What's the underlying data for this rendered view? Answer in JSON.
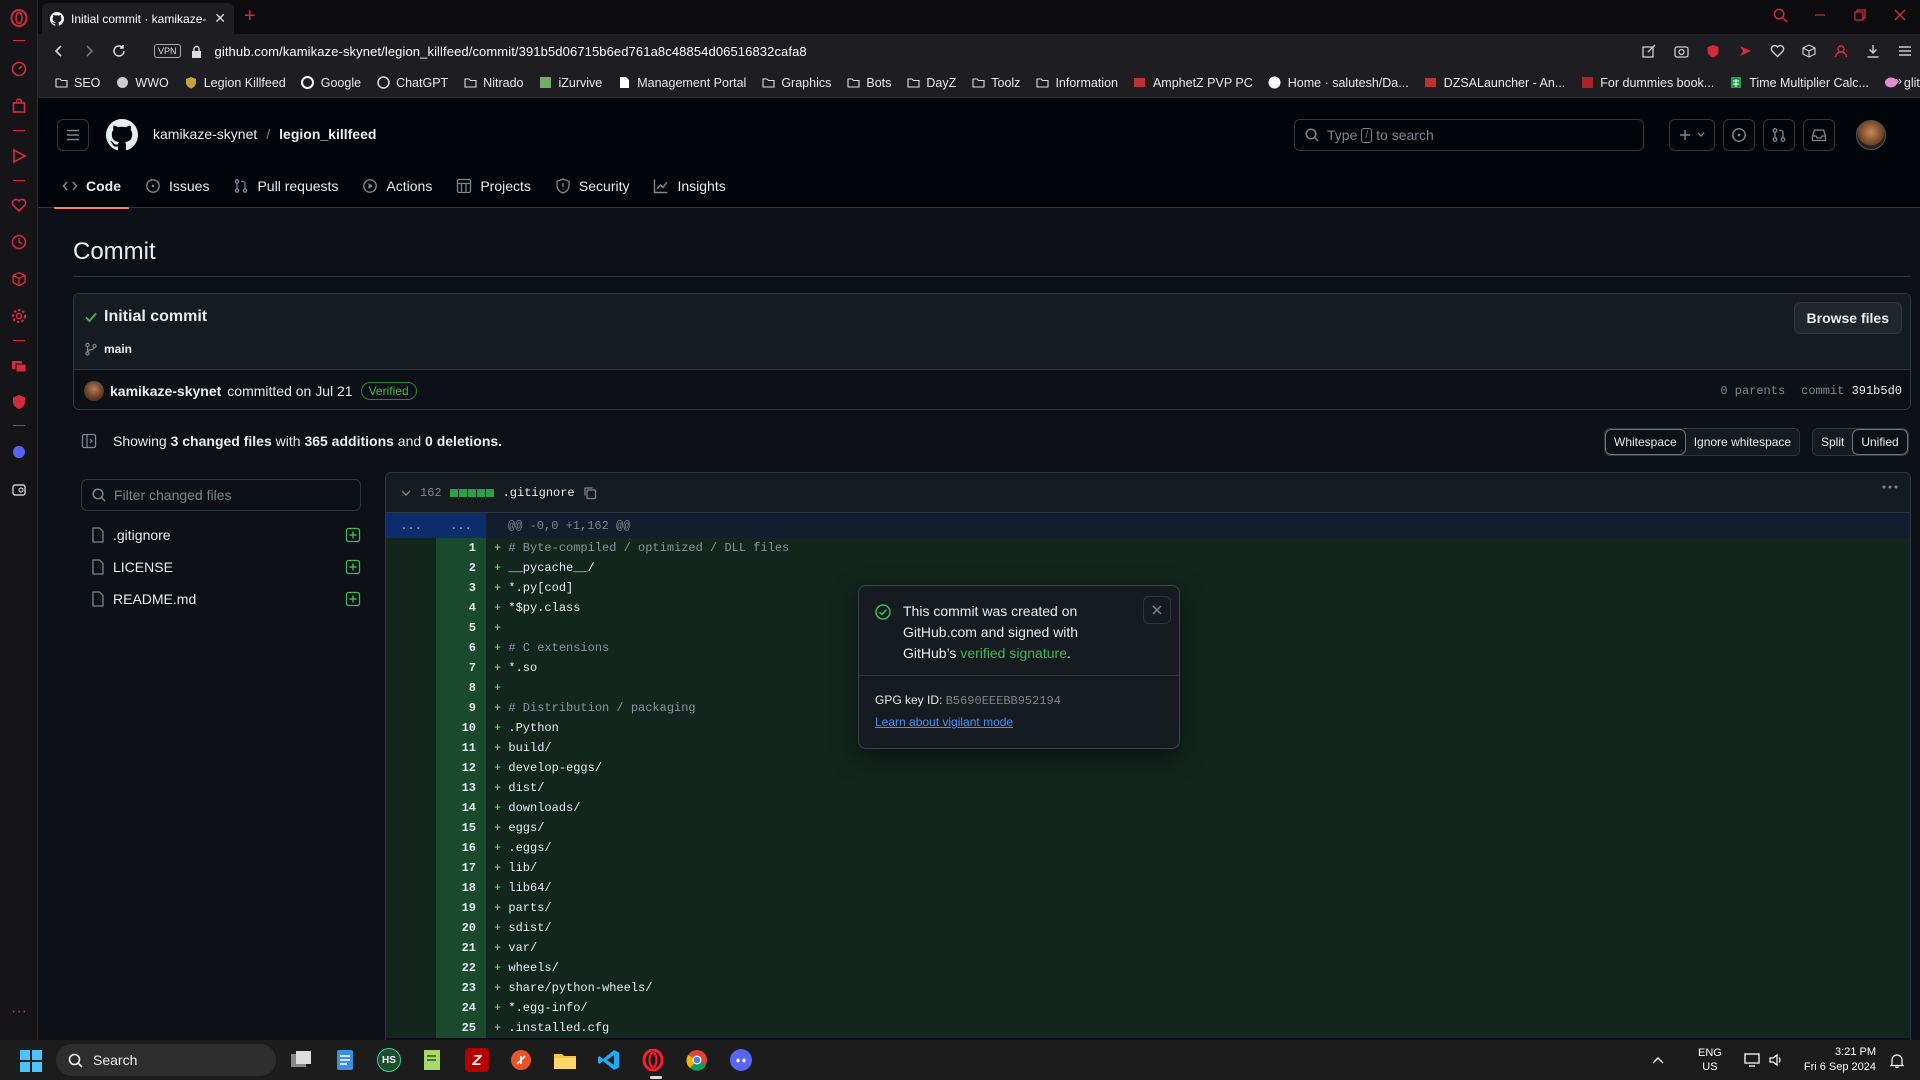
{
  "browser": {
    "tab_title": "Initial commit · kamikaze-s",
    "url": "github.com/kamikaze-skynet/legion_killfeed/commit/391b5d06715b6ed761a8c48854d06516832cafa8",
    "vpn_label": "VPN",
    "accent_color": "#d42a3c"
  },
  "bookmarks": [
    {
      "label": "SEO",
      "icon": "folder-icon"
    },
    {
      "label": "WWO",
      "icon": "paw-icon"
    },
    {
      "label": "Legion Killfeed",
      "icon": "shield-icon"
    },
    {
      "label": "Google",
      "icon": "google-icon"
    },
    {
      "label": "ChatGPT",
      "icon": "chatgpt-icon"
    },
    {
      "label": "Nitrado",
      "icon": "folder-icon"
    },
    {
      "label": "iZurvive",
      "icon": "map-icon"
    },
    {
      "label": "Management Portal",
      "icon": "page-icon"
    },
    {
      "label": "Graphics",
      "icon": "folder-icon"
    },
    {
      "label": "Bots",
      "icon": "folder-icon"
    },
    {
      "label": "DayZ",
      "icon": "folder-icon"
    },
    {
      "label": "Toolz",
      "icon": "folder-icon"
    },
    {
      "label": "Information",
      "icon": "folder-icon"
    },
    {
      "label": "AmphetZ PVP PC",
      "icon": "site-icon"
    },
    {
      "label": "Home · salutesh/Da...",
      "icon": "github-icon"
    },
    {
      "label": "DZSALauncher - An...",
      "icon": "site-icon"
    },
    {
      "label": "For dummies book...",
      "icon": "book-icon"
    },
    {
      "label": "Time Multiplier Calc...",
      "icon": "sheet-icon"
    },
    {
      "label": "glitch",
      "icon": "glitch-icon"
    }
  ],
  "github": {
    "owner": "kamikaze-skynet",
    "repo": "legion_killfeed",
    "search_placeholder": "Type / to search",
    "search_pre": "Type",
    "search_kbd": "/",
    "search_post": "to search",
    "nav": [
      "Code",
      "Issues",
      "Pull requests",
      "Actions",
      "Projects",
      "Security",
      "Insights"
    ]
  },
  "commit": {
    "heading": "Commit",
    "title": "Initial commit",
    "branch": "main",
    "browse_label": "Browse files",
    "author": "kamikaze-skynet",
    "committed_text": "committed on Jul 21",
    "verified_label": "Verified",
    "parents_text": "0 parents",
    "commit_label": "commit",
    "short_sha": "391b5d0"
  },
  "summary": {
    "showing": "Showing",
    "files": "3 changed files",
    "with": "with",
    "additions": "365 additions",
    "and": "and",
    "deletions": "0 deletions."
  },
  "view_controls": {
    "whitespace": "Whitespace",
    "ignore_whitespace": "Ignore whitespace",
    "split": "Split",
    "unified": "Unified"
  },
  "file_tree": {
    "filter_placeholder": "Filter changed files",
    "files": [
      ".gitignore",
      "LICENSE",
      "README.md"
    ]
  },
  "diff": {
    "file": ".gitignore",
    "count": "162",
    "hunk_left": "...",
    "hunk_right": "...",
    "hunk": "@@ -0,0 +1,162 @@",
    "lines": [
      {
        "n": "1",
        "text": "# Byte-compiled / optimized / DLL files"
      },
      {
        "n": "2",
        "text": "__pycache__/"
      },
      {
        "n": "3",
        "text": "*.py[cod]"
      },
      {
        "n": "4",
        "text": "*$py.class"
      },
      {
        "n": "5",
        "text": ""
      },
      {
        "n": "6",
        "text": "# C extensions"
      },
      {
        "n": "7",
        "text": "*.so"
      },
      {
        "n": "8",
        "text": ""
      },
      {
        "n": "9",
        "text": "# Distribution / packaging"
      },
      {
        "n": "10",
        "text": ".Python"
      },
      {
        "n": "11",
        "text": "build/"
      },
      {
        "n": "12",
        "text": "develop-eggs/"
      },
      {
        "n": "13",
        "text": "dist/"
      },
      {
        "n": "14",
        "text": "downloads/"
      },
      {
        "n": "15",
        "text": "eggs/"
      },
      {
        "n": "16",
        "text": ".eggs/"
      },
      {
        "n": "17",
        "text": "lib/"
      },
      {
        "n": "18",
        "text": "lib64/"
      },
      {
        "n": "19",
        "text": "parts/"
      },
      {
        "n": "20",
        "text": "sdist/"
      },
      {
        "n": "21",
        "text": "var/"
      },
      {
        "n": "22",
        "text": "wheels/"
      },
      {
        "n": "23",
        "text": "share/python-wheels/"
      },
      {
        "n": "24",
        "text": "*.egg-info/"
      },
      {
        "n": "25",
        "text": ".installed.cfg"
      }
    ]
  },
  "popover": {
    "msg1": "This commit was created on GitHub.com and signed with GitHub’s",
    "msg_link": "verified signature",
    "msg_end": ".",
    "gpg_label": "GPG key ID:",
    "gpg_value": "B5690EEEBB952194",
    "link": "Learn about vigilant mode"
  },
  "taskbar": {
    "search_label": "Search",
    "lang_top": "ENG",
    "lang_bottom": "US",
    "time": "3:21 PM",
    "date": "Fri 6 Sep 2024"
  }
}
